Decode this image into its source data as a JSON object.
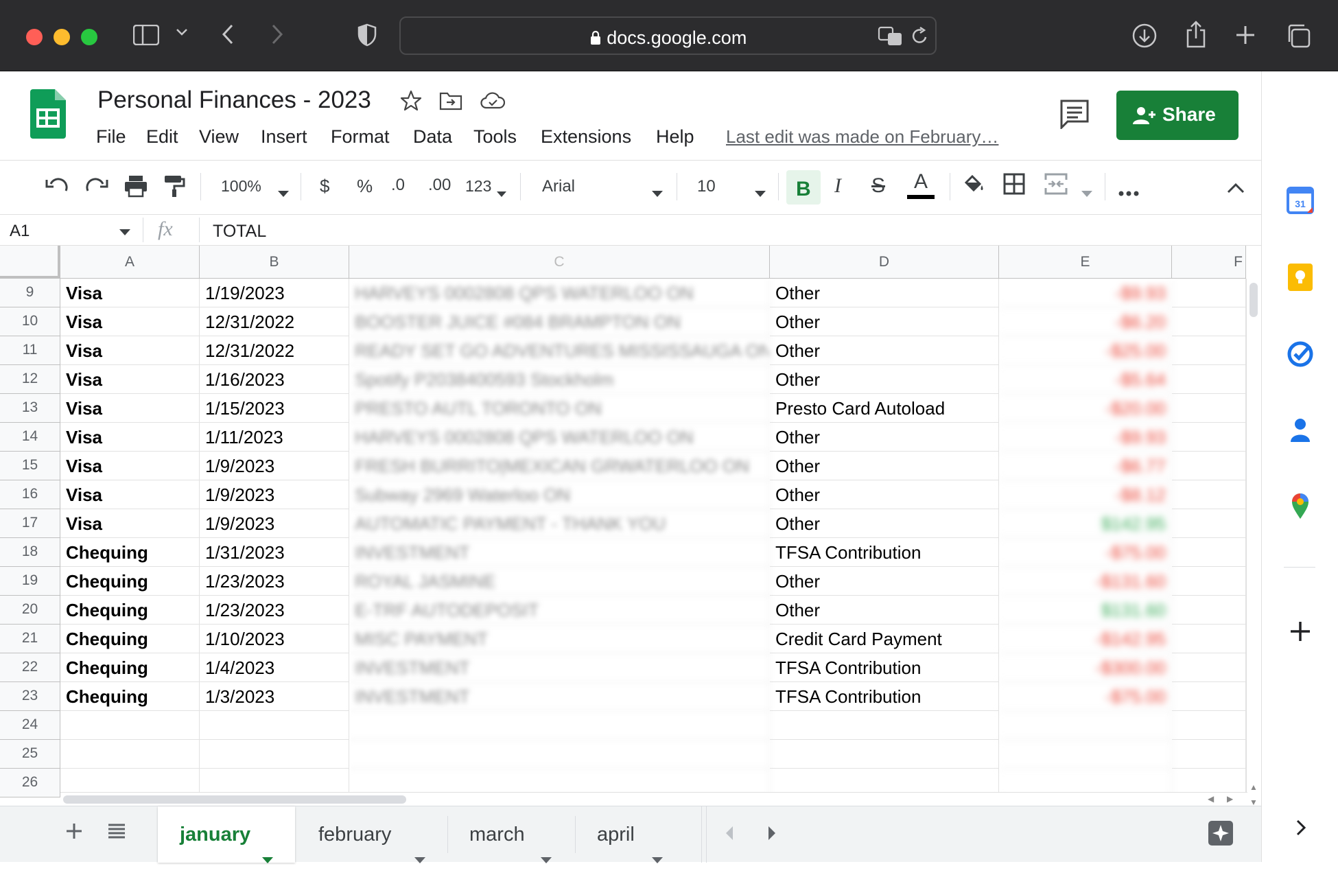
{
  "browser": {
    "url": "docs.google.com"
  },
  "app": {
    "title": "Personal Finances - 2023",
    "menu": [
      "File",
      "Edit",
      "View",
      "Insert",
      "Format",
      "Data",
      "Tools",
      "Extensions",
      "Help"
    ],
    "last_edit": "Last edit was made on February…",
    "share_label": "Share"
  },
  "toolbar": {
    "zoom": "100%",
    "currency": "$",
    "percent": "%",
    "dec_decrease": ".0",
    "dec_increase": ".00",
    "more_formats": "123",
    "font": "Arial",
    "font_size": "10",
    "bold": "B",
    "italic": "I",
    "strike": "S",
    "text_color": "A"
  },
  "formula_bar": {
    "cell_ref": "A1",
    "fx": "fx",
    "content": "TOTAL"
  },
  "grid": {
    "columns": [
      "A",
      "B",
      "C",
      "D",
      "E",
      "F"
    ],
    "rows": [
      {
        "n": "9",
        "a": "Visa",
        "b": "1/19/2023",
        "c": "HARVEYS 0002808 QPS WATERLOO ON",
        "d": "Other",
        "e": "-$9.93",
        "neg": true
      },
      {
        "n": "10",
        "a": "Visa",
        "b": "12/31/2022",
        "c": "BOOSTER JUICE #084 BRAMPTON ON",
        "d": "Other",
        "e": "-$6.20",
        "neg": true
      },
      {
        "n": "11",
        "a": "Visa",
        "b": "12/31/2022",
        "c": "READY SET GO ADVENTURES MISSISSAUGA ON",
        "d": "Other",
        "e": "-$25.00",
        "neg": true
      },
      {
        "n": "12",
        "a": "Visa",
        "b": "1/16/2023",
        "c": "Spotify P2038400593 Stockholm",
        "d": "Other",
        "e": "-$5.64",
        "neg": true
      },
      {
        "n": "13",
        "a": "Visa",
        "b": "1/15/2023",
        "c": "PRESTO AUTL TORONTO ON",
        "d": "Presto Card Autoload",
        "e": "-$20.00",
        "neg": true
      },
      {
        "n": "14",
        "a": "Visa",
        "b": "1/11/2023",
        "c": "HARVEYS 0002808 QPS WATERLOO ON",
        "d": "Other",
        "e": "-$9.93",
        "neg": true
      },
      {
        "n": "15",
        "a": "Visa",
        "b": "1/9/2023",
        "c": "FRESH BURRITO|MEXICAN GRWATERLOO ON",
        "d": "Other",
        "e": "-$6.77",
        "neg": true
      },
      {
        "n": "16",
        "a": "Visa",
        "b": "1/9/2023",
        "c": "Subway 2969 Waterloo ON",
        "d": "Other",
        "e": "-$8.12",
        "neg": true
      },
      {
        "n": "17",
        "a": "Visa",
        "b": "1/9/2023",
        "c": "AUTOMATIC PAYMENT - THANK YOU",
        "d": "Other",
        "e": "$142.95",
        "neg": false
      },
      {
        "n": "18",
        "a": "Chequing",
        "b": "1/31/2023",
        "c": "INVESTMENT",
        "d": "TFSA Contribution",
        "e": "-$75.00",
        "neg": true
      },
      {
        "n": "19",
        "a": "Chequing",
        "b": "1/23/2023",
        "c": "ROYAL JASMINE",
        "d": "Other",
        "e": "-$131.60",
        "neg": true
      },
      {
        "n": "20",
        "a": "Chequing",
        "b": "1/23/2023",
        "c": "E-TRF AUTODEPOSIT",
        "d": "Other",
        "e": "$131.60",
        "neg": false
      },
      {
        "n": "21",
        "a": "Chequing",
        "b": "1/10/2023",
        "c": "MISC PAYMENT",
        "d": "Credit Card Payment",
        "e": "-$142.95",
        "neg": true
      },
      {
        "n": "22",
        "a": "Chequing",
        "b": "1/4/2023",
        "c": "INVESTMENT",
        "d": "TFSA Contribution",
        "e": "-$300.00",
        "neg": true
      },
      {
        "n": "23",
        "a": "Chequing",
        "b": "1/3/2023",
        "c": "INVESTMENT",
        "d": "TFSA Contribution",
        "e": "-$75.00",
        "neg": true
      },
      {
        "n": "24",
        "a": "",
        "b": "",
        "c": "",
        "d": "",
        "e": "",
        "neg": true
      },
      {
        "n": "25",
        "a": "",
        "b": "",
        "c": "",
        "d": "",
        "e": "",
        "neg": true
      },
      {
        "n": "26",
        "a": "",
        "b": "",
        "c": "",
        "d": "",
        "e": "",
        "neg": true
      }
    ]
  },
  "sheets": [
    "january",
    "february",
    "march",
    "april"
  ],
  "active_sheet": "january",
  "colors": {
    "accent_green": "#188038",
    "negative": "#ea4335",
    "positive": "#34a853"
  }
}
